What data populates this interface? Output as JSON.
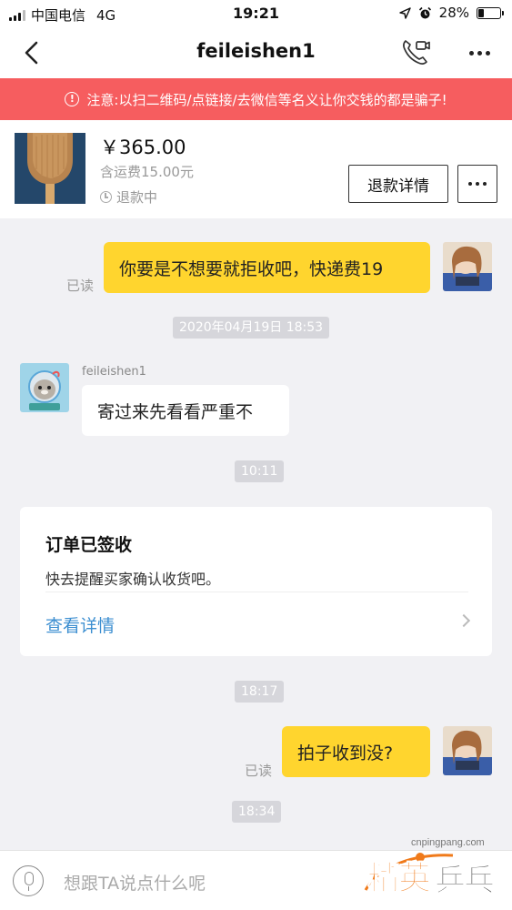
{
  "status_bar": {
    "carrier": "中国电信",
    "network": "4G",
    "time": "19:21",
    "battery": "28%",
    "battery_level": 0.28
  },
  "header": {
    "title": "feileishen1",
    "icons": [
      "back-icon",
      "video-call-icon",
      "more-icon"
    ]
  },
  "warning": {
    "text": "注意:以扫二维码/点链接/去微信等名义让你交钱的都是骗子!"
  },
  "product": {
    "price": "￥365.00",
    "shipping": "含运费15.00元",
    "status": "退款中",
    "refund_button": "退款详情"
  },
  "messages": {
    "m1": {
      "text": "你要是不想要就拒收吧，快递费19",
      "read": "已读"
    },
    "t1": "2020年04月19日 18:53",
    "m2": {
      "sender": "feileishen1",
      "text": "寄过来先看看严重不"
    },
    "t2": "10:11",
    "card": {
      "title": "订单已签收",
      "desc": "快去提醒买家确认收货吧。",
      "link": "查看详情"
    },
    "t3": "18:17",
    "m3": {
      "text": "拍子收到没?",
      "read": "已读"
    },
    "t4": "18:34"
  },
  "input": {
    "placeholder": "想跟TA说点什么呢"
  },
  "watermark": {
    "url": "cnpingpang.com",
    "text_a": "精英",
    "text_b": "乒乓网"
  },
  "colors": {
    "warning_bg": "#f65d5f",
    "bubble_self": "#ffd52e",
    "link": "#3d8fd1"
  }
}
